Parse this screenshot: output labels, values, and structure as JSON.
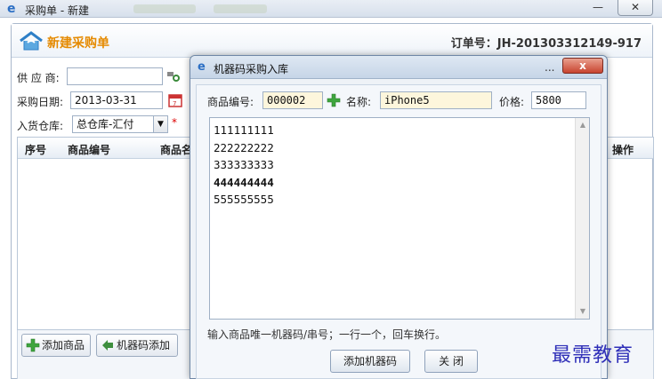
{
  "window": {
    "title": "采购单 - 新建",
    "minimize": "—",
    "close": "✕"
  },
  "header": {
    "title": "新建采购单",
    "order_label": "订单号：JH-201303312149-917"
  },
  "form": {
    "supplier_label": "供 应 商:",
    "supplier_value": "",
    "date_label": "采购日期:",
    "date_value": "2013-03-31",
    "warehouse_label": "入货仓库:",
    "warehouse_value": "总仓库-汇付",
    "required_mark": "*"
  },
  "grid": {
    "columns": [
      "序号",
      "商品编号",
      "商品名",
      "操作"
    ]
  },
  "toolbar": {
    "add_product": "添加商品",
    "add_serial": "机器码添加"
  },
  "dialog": {
    "title": "机器码采购入库",
    "dots": "...",
    "close": "x",
    "product_code_label": "商品编号:",
    "product_code_value": "000002",
    "name_label": "名称:",
    "name_value": "iPhone5",
    "price_label": "价格:",
    "price_value": "5800",
    "serials": [
      "111111111",
      "222222222",
      "333333333",
      "444444444",
      "555555555"
    ],
    "hint": "输入商品唯一机器码/串号；一行一个，回车换行。",
    "add_button": "添加机器码",
    "close_button": "关 闭"
  },
  "watermark": "最需教育",
  "icons": {
    "browser": "ie-icon",
    "house": "house-icon",
    "plus": "plus-icon",
    "calendar": "calendar-icon",
    "search": "search-icon",
    "back": "back-arrow-icon"
  },
  "colors": {
    "title_orange": "#e58a00",
    "close_red": "#c8442f",
    "watermark_blue": "#2f2fb8"
  }
}
